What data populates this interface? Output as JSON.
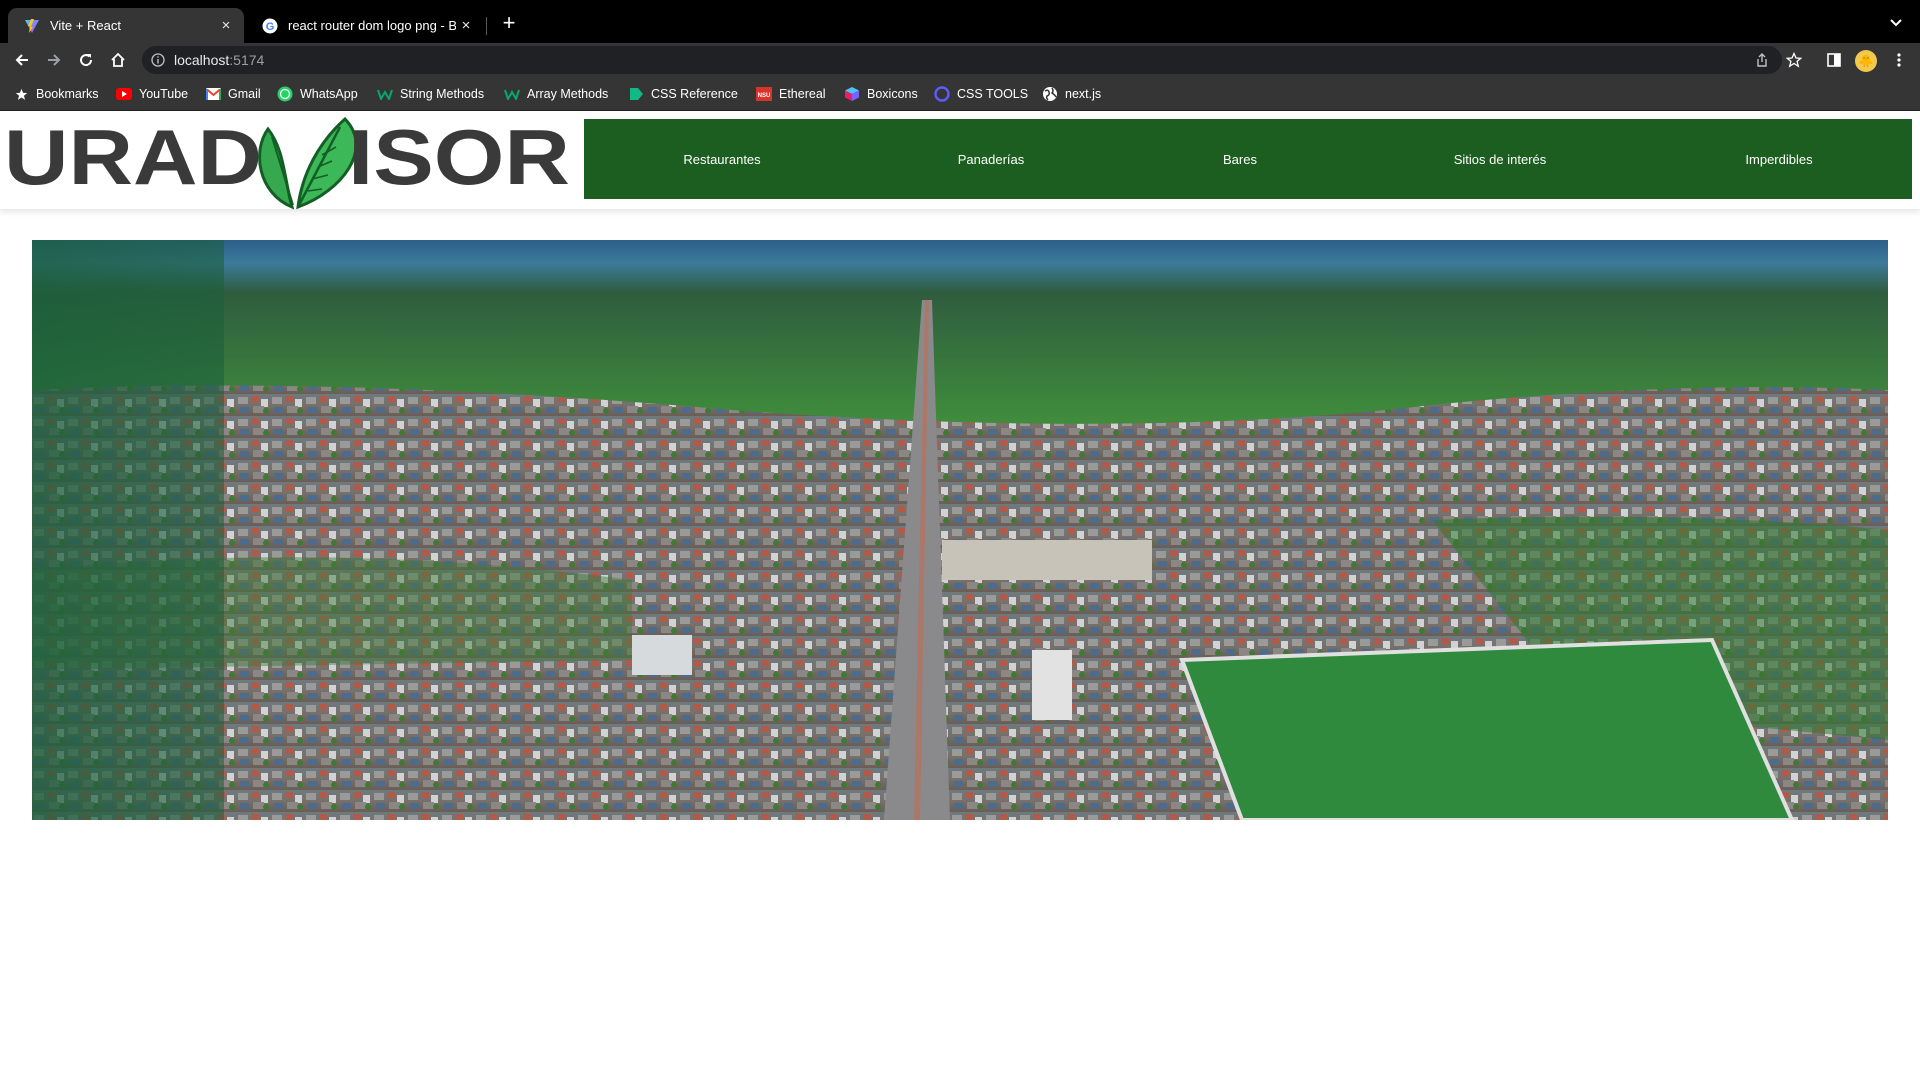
{
  "browser": {
    "tabs": [
      {
        "title": "Vite + React",
        "active": true,
        "favicon": "vite-logo-icon"
      },
      {
        "title": "react router dom logo png - Bu",
        "active": false,
        "favicon": "google-g-icon"
      }
    ],
    "new_tab_label": "+",
    "close_label": "×",
    "address": {
      "host": "localhost",
      "port": ":5174"
    },
    "profile_initial": "🐥",
    "bookmarks": [
      {
        "label": "Bookmarks",
        "icon": "star-icon"
      },
      {
        "label": "YouTube",
        "icon": "youtube-icon"
      },
      {
        "label": "Gmail",
        "icon": "gmail-icon"
      },
      {
        "label": "WhatsApp",
        "icon": "whatsapp-icon"
      },
      {
        "label": "String Methods",
        "icon": "w3-icon"
      },
      {
        "label": "Array Methods",
        "icon": "w3-icon"
      },
      {
        "label": "CSS Reference",
        "icon": "css-reference-icon"
      },
      {
        "label": "Ethereal",
        "icon": "ethereal-icon"
      },
      {
        "label": "Boxicons",
        "icon": "boxicons-icon"
      },
      {
        "label": "CSS TOOLS",
        "icon": "css-tools-icon"
      },
      {
        "label": "next.js",
        "icon": "globe-icon"
      }
    ]
  },
  "site": {
    "logo": {
      "left": "URAD",
      "right": "ISOR",
      "letter_color": "#3a3a3a",
      "leaf_color": "#2e9c45"
    },
    "nav": [
      "Restaurantes",
      "Panaderías",
      "Bares",
      "Sitios de interés",
      "Imperdibles"
    ],
    "nav_color": "#1b5e20",
    "hero": {
      "subject": "aerial view of city"
    }
  }
}
